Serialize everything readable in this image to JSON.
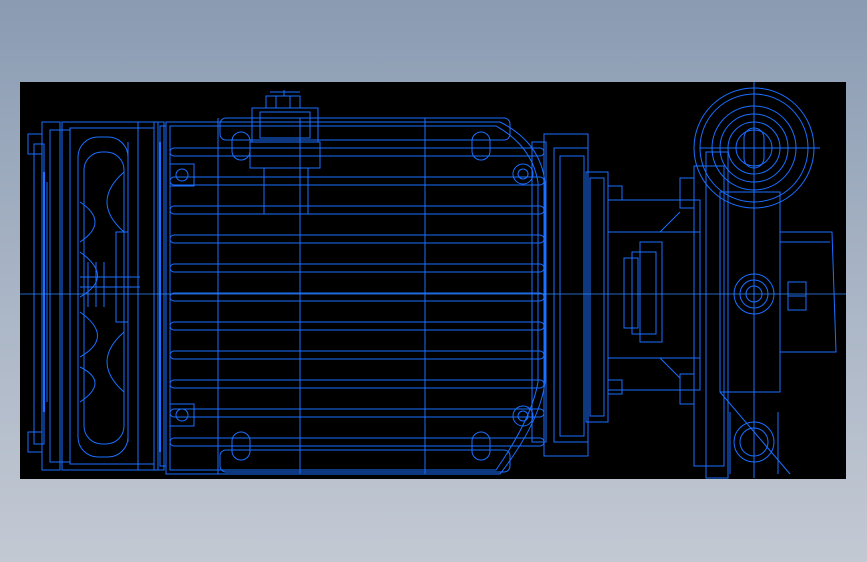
{
  "viewport": {
    "background_top": "#8a9bb2",
    "background_bottom": "#c3c9d3"
  },
  "drawing": {
    "background": "#000000",
    "line_color": "#1a6fff",
    "line_color_light": "#2f86ff",
    "subject_icon": "motor-with-gearbox-wireframe"
  }
}
